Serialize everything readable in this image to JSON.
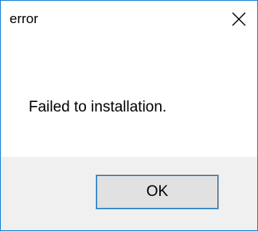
{
  "window": {
    "title": "error",
    "close_icon": "close-icon"
  },
  "dialog": {
    "message": "Failed to installation."
  },
  "buttons": {
    "ok_label": "OK"
  },
  "colors": {
    "window_border": "#1883d7",
    "footer_background": "#f0f0f0",
    "button_background": "#e1e1e1",
    "button_focus": "#0078d7"
  }
}
